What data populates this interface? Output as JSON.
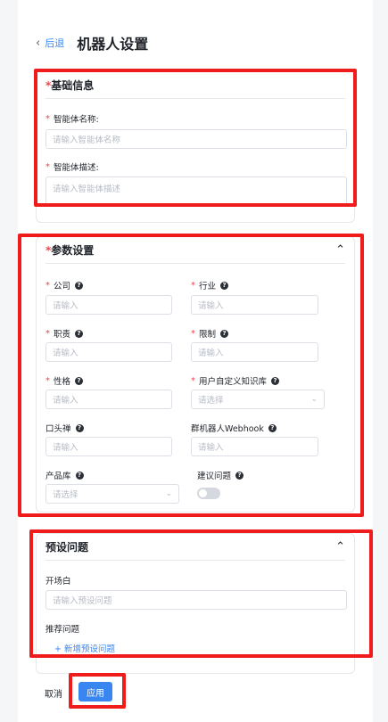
{
  "header": {
    "back_label": "后退",
    "title": "机器人设置"
  },
  "basic": {
    "title": "基础信息",
    "name_label": "智能体名称:",
    "name_placeholder": "请输入智能体名称",
    "desc_label": "智能体描述:",
    "desc_placeholder": "请输入智能体描述"
  },
  "params": {
    "title": "参数设置",
    "company_label": "公司",
    "company_placeholder": "请输入",
    "industry_label": "行业",
    "industry_placeholder": "请输入",
    "duty_label": "职责",
    "duty_placeholder": "请输入",
    "limit_label": "限制",
    "limit_placeholder": "请输入",
    "character_label": "性格",
    "character_placeholder": "请输入",
    "kb_label": "用户自定义知识库",
    "kb_placeholder": "请选择",
    "catchphrase_label": "口头禅",
    "catchphrase_placeholder": "请输入",
    "webhook_label": "群机器人Webhook",
    "webhook_placeholder": "请输入",
    "product_label": "产品库",
    "product_placeholder": "请选择",
    "suggest_label": "建议问题",
    "suggest_enabled": false
  },
  "preset": {
    "title": "预设问题",
    "opening_label": "开场白",
    "opening_placeholder": "请输入预设问题",
    "recommend_label": "推荐问题",
    "add_label": "+ 新增预设问题"
  },
  "footer": {
    "cancel_label": "取消",
    "apply_label": "应用"
  },
  "colors": {
    "accent": "#3a86f0",
    "required": "#e5484d",
    "highlight": "#f01b1b"
  }
}
